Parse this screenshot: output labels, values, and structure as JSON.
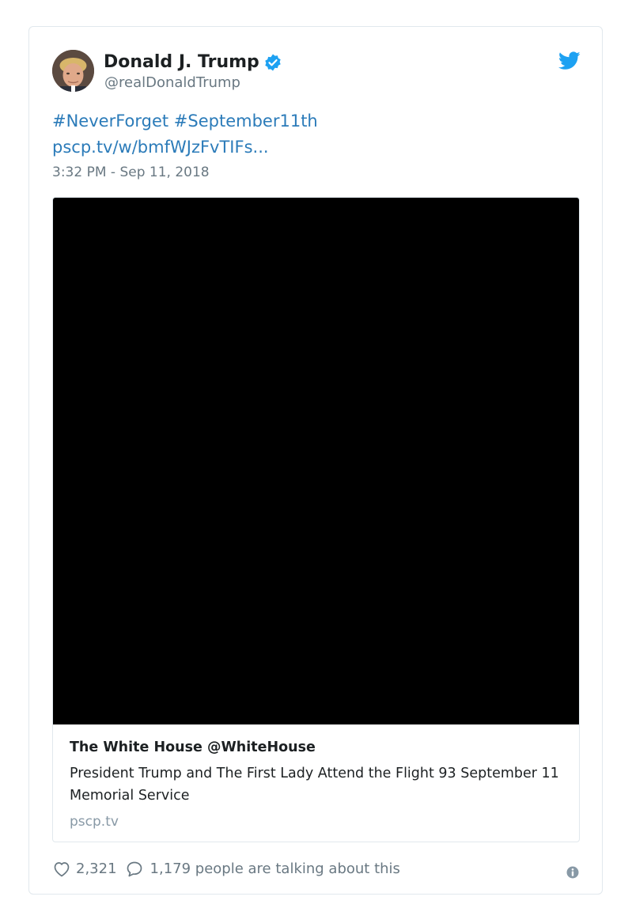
{
  "author": {
    "name": "Donald J. Trump",
    "handle": "@realDonaldTrump",
    "verified": true,
    "avatar_icon": "profile-photo"
  },
  "tweet": {
    "hashtags_line": "#NeverForget #September11th",
    "link_text": "pscp.tv/w/bmfWJzFvTIFs...",
    "timestamp": "3:32 PM - Sep 11, 2018"
  },
  "card": {
    "title": "The White House @WhiteHouse",
    "description": "President Trump and The First Lady Attend the Flight 93 September 11 Memorial Service",
    "domain": "pscp.tv"
  },
  "footer": {
    "likes": "2,321",
    "replies_text": "1,179 people are talking about this"
  },
  "colors": {
    "link": "#2b7bb9",
    "twitter_blue": "#1da1f2",
    "muted": "#697882",
    "border": "#e1e8ed"
  }
}
